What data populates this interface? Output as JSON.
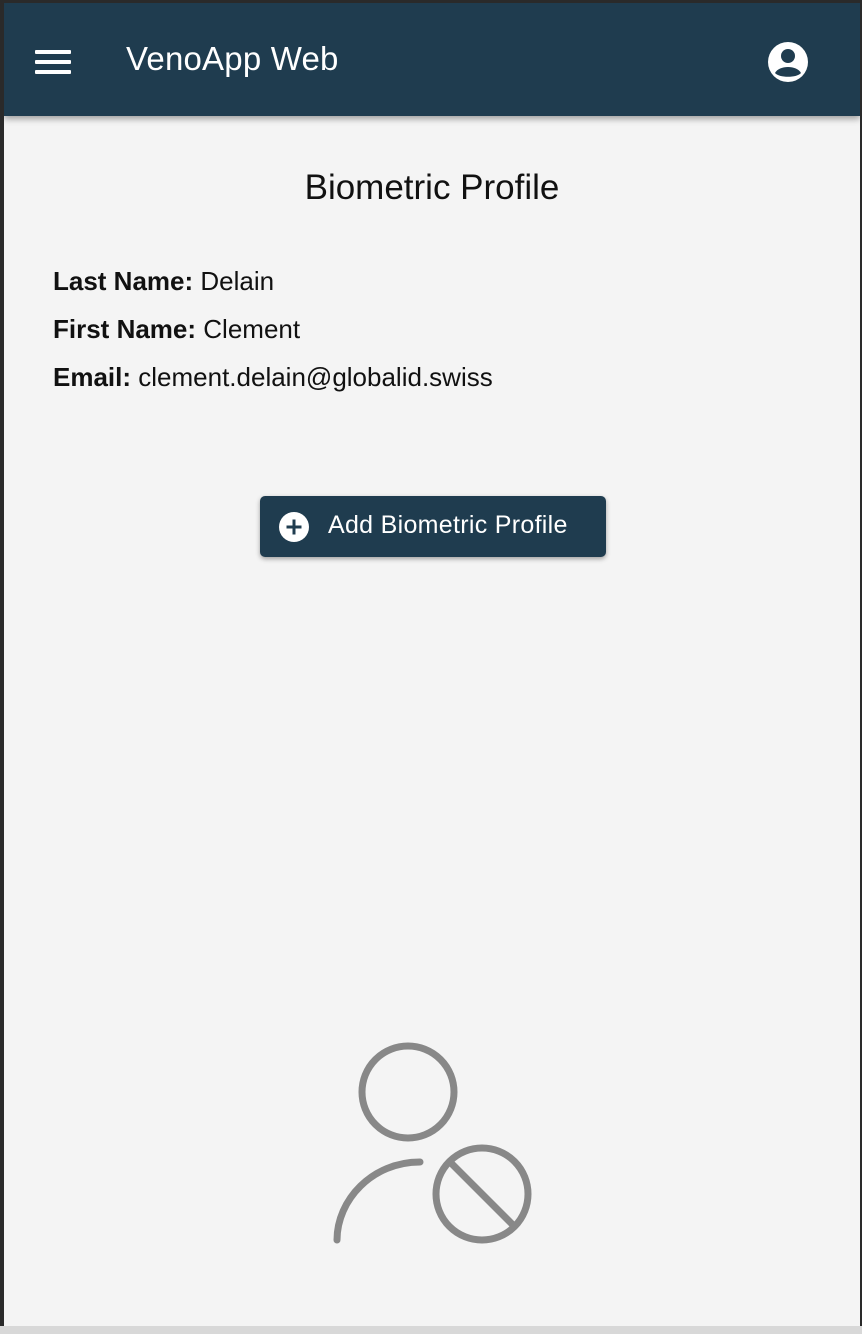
{
  "appbar": {
    "title": "VenoApp Web",
    "menu_icon": "hamburger-menu-icon",
    "account_icon": "account-circle-icon",
    "background": "#1f3c4f"
  },
  "page": {
    "title": "Biometric Profile"
  },
  "profile": {
    "last_name_label": "Last Name:",
    "last_name": "Delain",
    "first_name_label": "First Name:",
    "first_name": "Clement",
    "email_label": "Email:",
    "email": "clement.delain@globalid.swiss"
  },
  "actions": {
    "add_biometric_profile_label": "Add Biometric Profile",
    "add_icon": "add-circle-icon"
  },
  "empty_state": {
    "icon": "person-blocked-icon",
    "icon_color": "#888888"
  }
}
